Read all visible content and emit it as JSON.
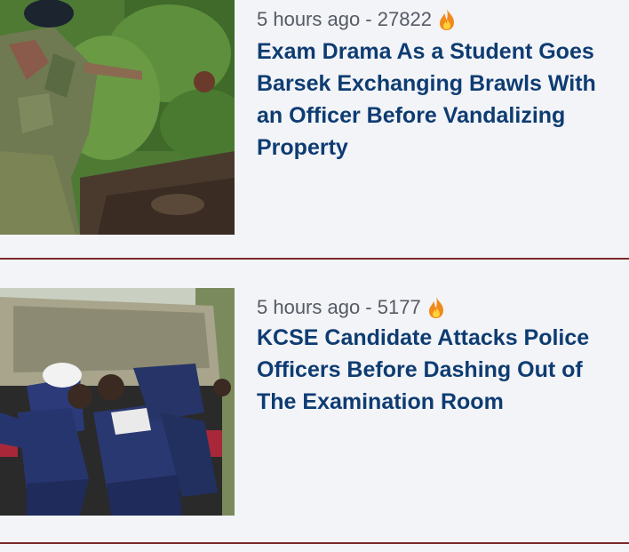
{
  "articles": [
    {
      "meta": "5 hours ago - 27822",
      "title": "Exam Drama As a Student Goes Barsek Exchanging Brawls With an Officer Before Vandalizing Property",
      "trend_icon": "fire-icon"
    },
    {
      "meta": "5 hours ago - 5177",
      "title": "KCSE Candidate Attacks Police Officers Before Dashing Out of The Examination Room",
      "trend_icon": "fire-icon"
    }
  ],
  "colors": {
    "background": "#f3f4f8",
    "headline": "#0e3c72",
    "meta": "#555a63",
    "divider": "#7a2a2a",
    "fire": "#f08a1c"
  }
}
